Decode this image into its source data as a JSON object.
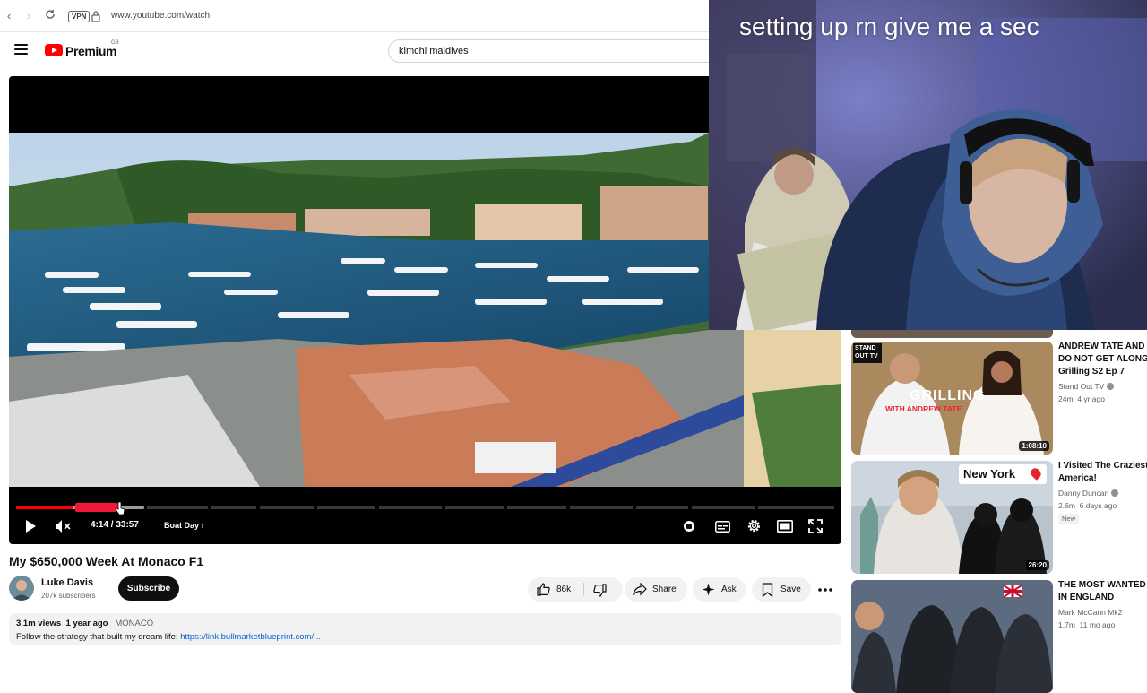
{
  "browser": {
    "url": "www.youtube.com/watch",
    "vpn_label": "VPN"
  },
  "masthead": {
    "logo_text": "Premium",
    "region": "GB",
    "search_value": "kimchi maldives"
  },
  "player": {
    "time": "4:14 / 33:57",
    "chapter": "Boat Day",
    "progress_fraction": 0.125
  },
  "video": {
    "title": "My $650,000 Week At Monaco F1",
    "channel_name": "Luke Davis",
    "subscribers": "207k subscribers",
    "subscribe_label": "Subscribe",
    "likes": "86k",
    "share_label": "Share",
    "ask_label": "Ask",
    "save_label": "Save"
  },
  "description": {
    "views": "3.1m views",
    "age": "1 year ago",
    "tag": "MONACO",
    "text": "Follow the strategy that built my dream life: ",
    "link": "https://link.bullmarketblueprint.com/..."
  },
  "recommendations": [
    {
      "title_line1": "ANDREW TATE AND C",
      "title_line2": "DO NOT GET ALONG |",
      "title_line3": "Grilling S2 Ep 7",
      "channel": "Stand Out TV",
      "views": "24m",
      "age": "4 yr ago",
      "duration": "1:08:10",
      "thumb_logo": "STAND OUT TV",
      "thumb_text": "GRILLING",
      "thumb_sub": "WITH ANDREW TATE"
    },
    {
      "title_line1": "I Visited The Craziest C",
      "title_line2": "America!",
      "channel": "Danny Duncan",
      "views": "2.6m",
      "age": "6 days ago",
      "badge": "New",
      "duration": "26:20",
      "thumb_text": "New York"
    },
    {
      "title_line1": "THE MOST WANTED D",
      "title_line2": "IN ENGLAND",
      "channel": "Mark McCann Mk2",
      "views": "1.7m",
      "age": "11 mo ago"
    }
  ],
  "overlay": {
    "text": "setting up rn give me a sec"
  },
  "colors": {
    "brand_red": "#ff0000",
    "progress_hover": "#f0183a",
    "link": "#065fd4"
  }
}
